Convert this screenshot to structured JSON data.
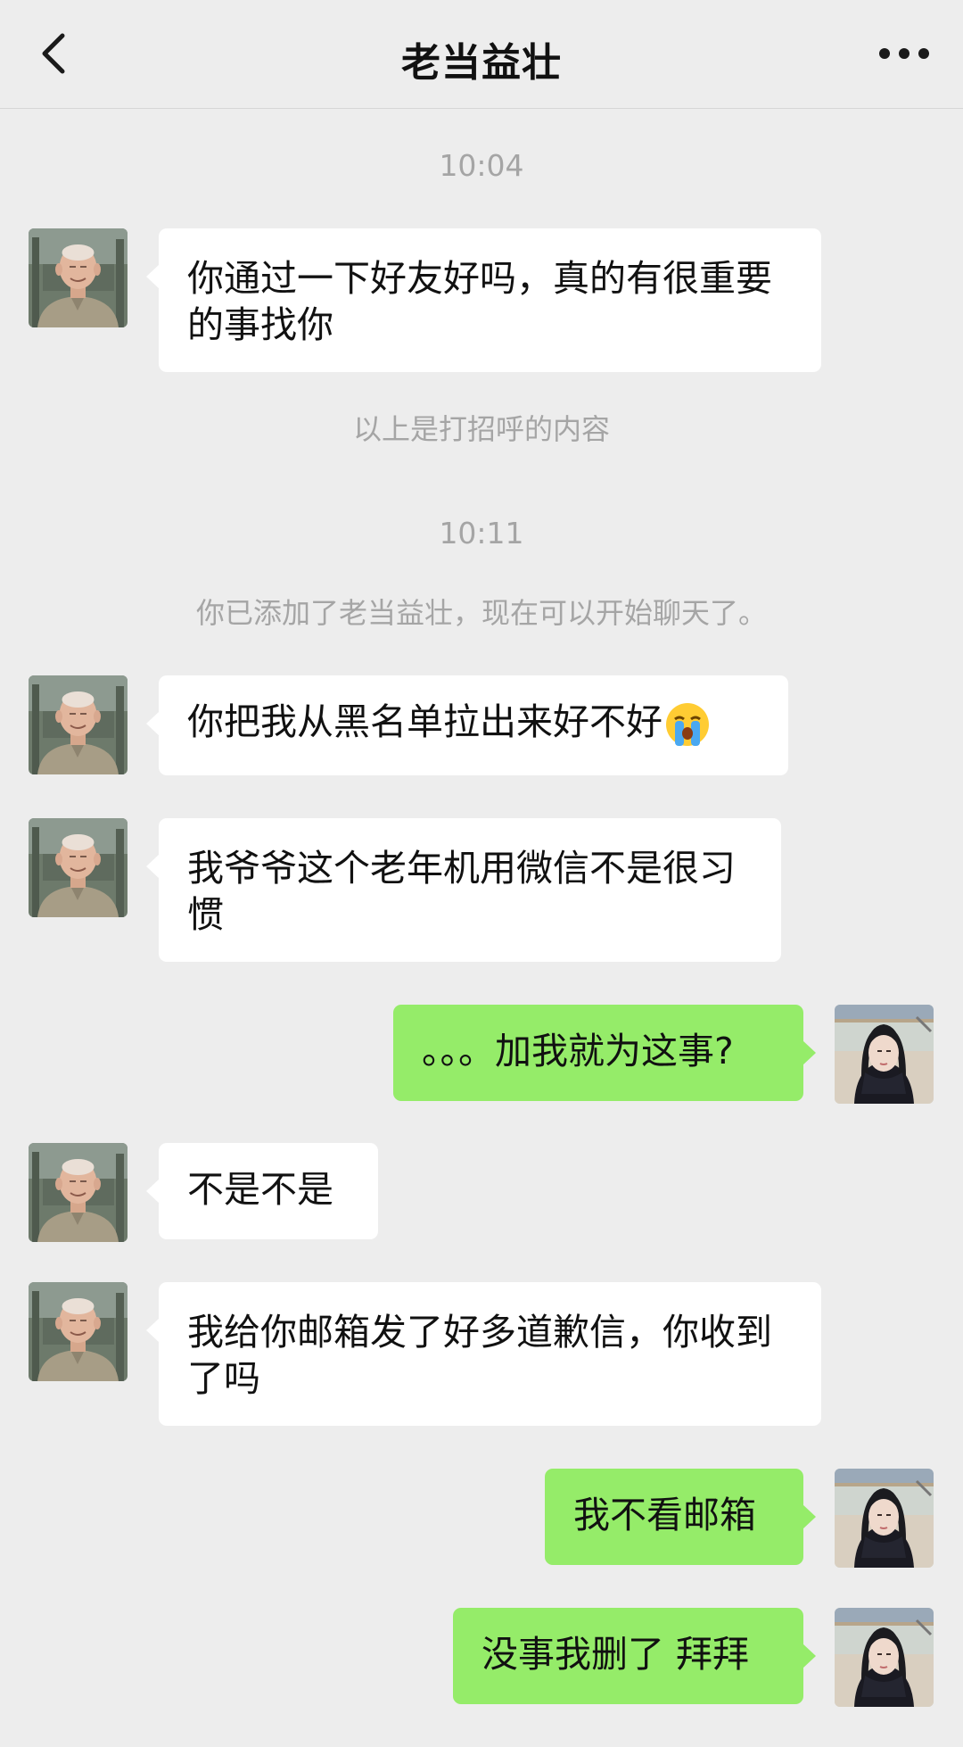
{
  "header": {
    "title": "老当益壮",
    "back_icon": "chevron-left-icon",
    "more_icon": "more-horizontal-icon"
  },
  "colors": {
    "background": "#ededed",
    "incoming_bubble": "#ffffff",
    "outgoing_bubble": "#95ec69",
    "system_text": "#a5a5a5"
  },
  "chat": {
    "time_1": "10:04",
    "msg_1": "你通过一下好友好吗，真的有很重要的事找你",
    "sys_greeting": "以上是打招呼的内容",
    "time_2": "10:11",
    "sys_added": "你已添加了老当益壮，现在可以开始聊天了。",
    "msg_2": "你把我从黑名单拉出来好不好",
    "msg_2_emoji": "loudly-crying-face-emoji",
    "msg_3": "我爷爷这个老年机用微信不是很习惯",
    "msg_4": "。。。加我就为这事?",
    "msg_5": "不是不是",
    "msg_6": "我给你邮箱发了好多道歉信，你收到了吗",
    "msg_7": "我不看邮箱",
    "msg_8": "没事我删了 拜拜"
  }
}
